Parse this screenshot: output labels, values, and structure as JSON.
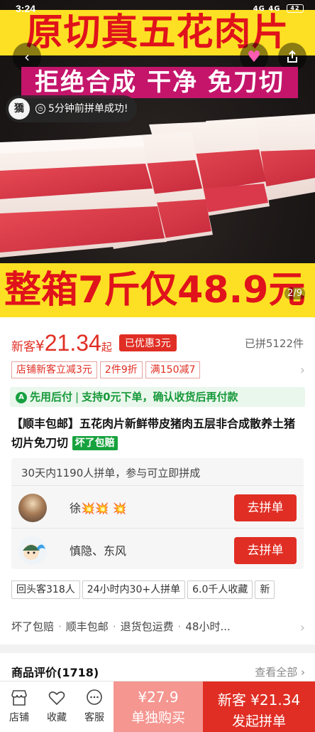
{
  "status_bar": {
    "time": "3:24",
    "signal": "4G 4G",
    "battery": "42"
  },
  "hero": {
    "banner_top": "原切真五花肉片",
    "banner_sub": "拒绝合成 干净 免刀切",
    "ticker_avatar_text": "獢",
    "ticker_text": "5分钟前拼单成功!",
    "banner_bottom": "整箱7斤仅48.9元",
    "pager": "2/9",
    "icons": [
      "back-icon",
      "heart-icon",
      "share-icon"
    ]
  },
  "price": {
    "new_customer_label": "新客",
    "currency": "¥",
    "amount": "21.34",
    "from_suffix": "起",
    "discount_badge": "已优惠3元",
    "sold_text": "已拼5122件"
  },
  "coupons": [
    "店铺新客立减3元",
    "2件9折",
    "满150减7"
  ],
  "paylater": {
    "label": "先用后付",
    "desc": "支持0元下单，确认收货后再付款"
  },
  "product": {
    "title": "【顺丰包邮】五花肉片新鲜带皮猪肉五层非合成散养土猪切片免刀切",
    "tag": "坏了包赔"
  },
  "group_buy": {
    "header": "30天内1190人拼单，参与可立即拼成",
    "rows": [
      {
        "name": "徐💥💥  💥",
        "button": "去拼单"
      },
      {
        "name": "慎隐、东风",
        "button": "去拼单"
      }
    ]
  },
  "features": [
    "回头客318人",
    "24小时内30+人拼单",
    "6.0千人收藏",
    "新"
  ],
  "services": [
    "坏了包赔",
    "顺丰包邮",
    "退货包运费",
    "48小时..."
  ],
  "reviews": {
    "label": "商品评价(1718)",
    "view_all": "查看全部"
  },
  "bottom_bar": {
    "store": "店铺",
    "favorite": "收藏",
    "service": "客服",
    "single_price": "¥27.9",
    "single_label": "单独购买",
    "group_price": "新客 ¥21.34",
    "group_label": "发起拼单"
  },
  "colors": {
    "accent": "#e02e24",
    "banner_yellow": "#fde023",
    "banner_magenta": "#c4156b",
    "green": "#16993a"
  }
}
